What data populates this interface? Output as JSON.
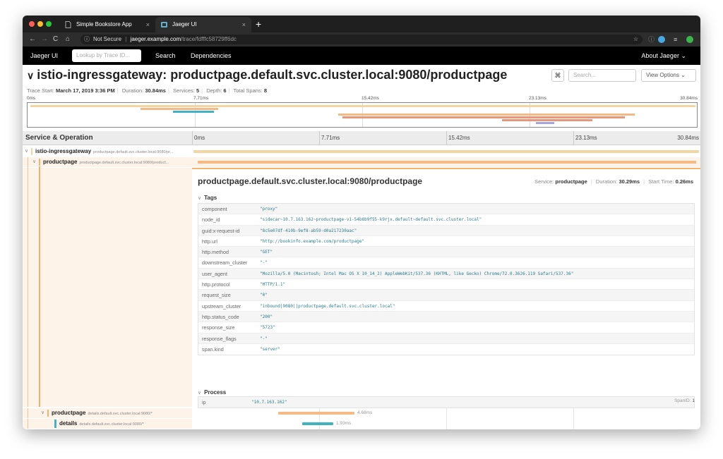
{
  "browser": {
    "tabs": [
      {
        "title": "Simple Bookstore App",
        "active": false
      },
      {
        "title": "Jaeger UI",
        "active": true
      }
    ],
    "new_tab": "+",
    "close_glyph": "×",
    "url_info": "Not Secure",
    "url_separator": "|",
    "url_host": "jaeger.example.com",
    "url_path": "/trace/fdfffc58729ff6dc"
  },
  "nav": {
    "brand": "Jaeger UI",
    "lookup_placeholder": "Lookup by Trace ID...",
    "search": "Search",
    "dependencies": "Dependencies",
    "about": "About Jaeger ⌄"
  },
  "trace": {
    "title": "istio-ingressgateway: productpage.default.svc.cluster.local:9080/productpage",
    "cmd_glyph": "⌘",
    "find_placeholder": "Search...",
    "view_options": "View Options ⌄",
    "start_label": "Trace Start:",
    "start": "March 17, 2019 3:36 PM",
    "duration_label": "Duration:",
    "duration": "30.84ms",
    "services_label": "Services:",
    "services": "5",
    "depth_label": "Depth:",
    "depth": "6",
    "spans_label": "Total Spans:",
    "spans": "8"
  },
  "ticks": [
    "0ms",
    "7.71ms",
    "15.42ms",
    "23.13ms",
    "30.84ms"
  ],
  "timeline": {
    "column_title": "Service & Operation"
  },
  "spans": [
    {
      "service": "istio-ingressgateway",
      "operation": "productpage.default.svc.cluster.local:9080/pr..."
    },
    {
      "service": "productpage",
      "operation": "productpage.default.svc.cluster.local:9080/product..."
    },
    {
      "service": "productpage",
      "operation": "details.default.svc.cluster.local:9080/*",
      "duration": "4.68ms"
    },
    {
      "service": "details",
      "operation": "details.default.svc.cluster.local:9080/*",
      "duration": "1.93ms"
    }
  ],
  "detail": {
    "title": "productpage.default.svc.cluster.local:9080/productpage",
    "service_label": "Service:",
    "service": "productpage",
    "duration_label": "Duration:",
    "duration": "30.29ms",
    "start_label": "Start Time:",
    "start": "0.26ms",
    "tags_title": "Tags",
    "tags": [
      {
        "key": "component",
        "value": "\"proxy\""
      },
      {
        "key": "node_id",
        "value": "\"sidecar~10.7.163.162~productpage-v1-54b8b9f55-k9rjx.default~default.svc.cluster.local\""
      },
      {
        "key": "guid:x-request-id",
        "value": "\"8c5e07df-410b-9ef8-ab59-d0a217230aac\""
      },
      {
        "key": "http.url",
        "value": "\"http://bookinfo.example.com/productpage\""
      },
      {
        "key": "http.method",
        "value": "\"GET\""
      },
      {
        "key": "downstream_cluster",
        "value": "\"-\""
      },
      {
        "key": "user_agent",
        "value": "\"Mozilla/5.0 (Macintosh; Intel Mac OS X 10_14_2) AppleWebKit/537.36 (KHTML, like Gecko) Chrome/72.0.3626.119 Safari/537.36\""
      },
      {
        "key": "http.protocol",
        "value": "\"HTTP/1.1\""
      },
      {
        "key": "request_size",
        "value": "\"0\""
      },
      {
        "key": "upstream_cluster",
        "value": "\"inbound|9080||productpage.default.svc.cluster.local\""
      },
      {
        "key": "http.status_code",
        "value": "\"200\""
      },
      {
        "key": "response_size",
        "value": "\"5723\""
      },
      {
        "key": "response_flags",
        "value": "\"-\""
      },
      {
        "key": "span.kind",
        "value": "\"server\""
      }
    ],
    "process_title": "Process",
    "process": [
      {
        "key": "ip",
        "value": "\"10.7.163.162\""
      }
    ],
    "spanid_label": "SpanID:",
    "spanid": "1"
  },
  "colors": {
    "ingress": "#f3d5a1",
    "productpage": "#f4b984",
    "details": "#3fb3bf",
    "reviews": "#e8967a",
    "ratings": "#a9a4d8",
    "accent": "#f4b26b"
  }
}
